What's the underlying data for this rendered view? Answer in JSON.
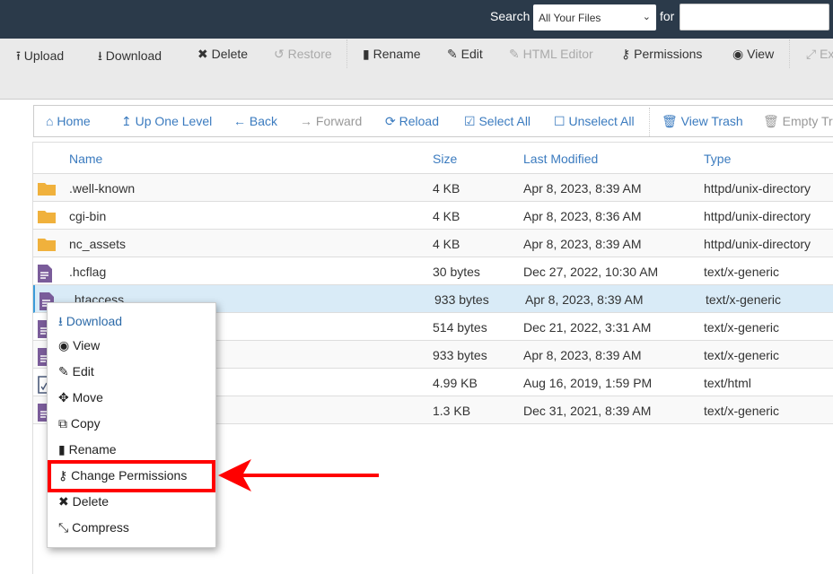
{
  "search": {
    "label": "Search",
    "scope": "All Your Files",
    "for_label": "for",
    "value": ""
  },
  "toolbar": [
    {
      "label": "Upload",
      "icon": "upload-icon",
      "enabled": true
    },
    {
      "label": "Download",
      "icon": "download-icon",
      "enabled": true
    },
    {
      "label": "Delete",
      "icon": "delete-icon",
      "enabled": true
    },
    {
      "label": "Restore",
      "icon": "restore-icon",
      "enabled": false
    },
    {
      "label": "Rename",
      "icon": "file-icon",
      "enabled": true
    },
    {
      "label": "Edit",
      "icon": "pencil-icon",
      "enabled": true
    },
    {
      "label": "HTML Editor",
      "icon": "edit-icon",
      "enabled": false
    },
    {
      "label": "Permissions",
      "icon": "key-icon",
      "enabled": true
    },
    {
      "label": "View",
      "icon": "eye-icon",
      "enabled": true
    },
    {
      "label": "Ex",
      "icon": "expand-icon",
      "enabled": false
    }
  ],
  "nav": [
    {
      "label": "Home",
      "icon": "home-icon",
      "enabled": true
    },
    {
      "label": "Up One Level",
      "icon": "up-icon",
      "enabled": true
    },
    {
      "label": "Back",
      "icon": "arrow-left-icon",
      "enabled": true
    },
    {
      "label": "Forward",
      "icon": "arrow-right-icon",
      "enabled": false
    },
    {
      "label": "Reload",
      "icon": "reload-icon",
      "enabled": true
    },
    {
      "label": "Select All",
      "icon": "checkbox-checked-icon",
      "enabled": true
    },
    {
      "label": "Unselect All",
      "icon": "checkbox-icon",
      "enabled": true
    },
    {
      "label": "View Trash",
      "icon": "trash-icon",
      "enabled": true
    },
    {
      "label": "Empty Tra",
      "icon": "trash-icon",
      "enabled": false
    }
  ],
  "table": {
    "headers": [
      "Name",
      "Size",
      "Last Modified",
      "Type"
    ],
    "rows": [
      {
        "name": ".well-known",
        "size": "4 KB",
        "modified": "Apr 8, 2023, 8:39 AM",
        "type": "httpd/unix-directory",
        "icon": "folder"
      },
      {
        "name": "cgi-bin",
        "size": "4 KB",
        "modified": "Apr 8, 2023, 8:36 AM",
        "type": "httpd/unix-directory",
        "icon": "folder"
      },
      {
        "name": "nc_assets",
        "size": "4 KB",
        "modified": "Apr 8, 2023, 8:39 AM",
        "type": "httpd/unix-directory",
        "icon": "folder"
      },
      {
        "name": ".hcflag",
        "size": "30 bytes",
        "modified": "Dec 27, 2022, 10:30 AM",
        "type": "text/x-generic",
        "icon": "text"
      },
      {
        "name": ".htaccess",
        "size": "933 bytes",
        "modified": "Apr 8, 2023, 8:39 AM",
        "type": "text/x-generic",
        "icon": "text",
        "selected": true
      },
      {
        "name": "",
        "size": "514 bytes",
        "modified": "Dec 21, 2022, 3:31 AM",
        "type": "text/x-generic",
        "icon": "text"
      },
      {
        "name": "",
        "size": "933 bytes",
        "modified": "Apr 8, 2023, 8:39 AM",
        "type": "text/x-generic",
        "icon": "text"
      },
      {
        "name": "",
        "size": "4.99 KB",
        "modified": "Aug 16, 2019, 1:59 PM",
        "type": "text/html",
        "icon": "html"
      },
      {
        "name": "",
        "size": "1.3 KB",
        "modified": "Dec 31, 2021, 8:39 AM",
        "type": "text/x-generic",
        "icon": "text"
      }
    ]
  },
  "context_menu": [
    {
      "label": "Download",
      "icon": "download-icon"
    },
    {
      "label": "View",
      "icon": "eye-icon"
    },
    {
      "label": "Edit",
      "icon": "pencil-icon"
    },
    {
      "label": "Move",
      "icon": "move-icon"
    },
    {
      "label": "Copy",
      "icon": "copy-icon"
    },
    {
      "label": "Rename",
      "icon": "file-icon"
    },
    {
      "label": "Change Permissions",
      "icon": "key-icon",
      "highlighted": true
    },
    {
      "label": "Delete",
      "icon": "delete-icon"
    },
    {
      "label": "Compress",
      "icon": "compress-icon"
    }
  ],
  "colors": {
    "topbar": "#2b3a4a",
    "link": "#3b7bbf",
    "highlight": "#ff0000",
    "selected_row": "#d9ebf7",
    "folder": "#f0b13c",
    "file": "#7a5c9a"
  }
}
